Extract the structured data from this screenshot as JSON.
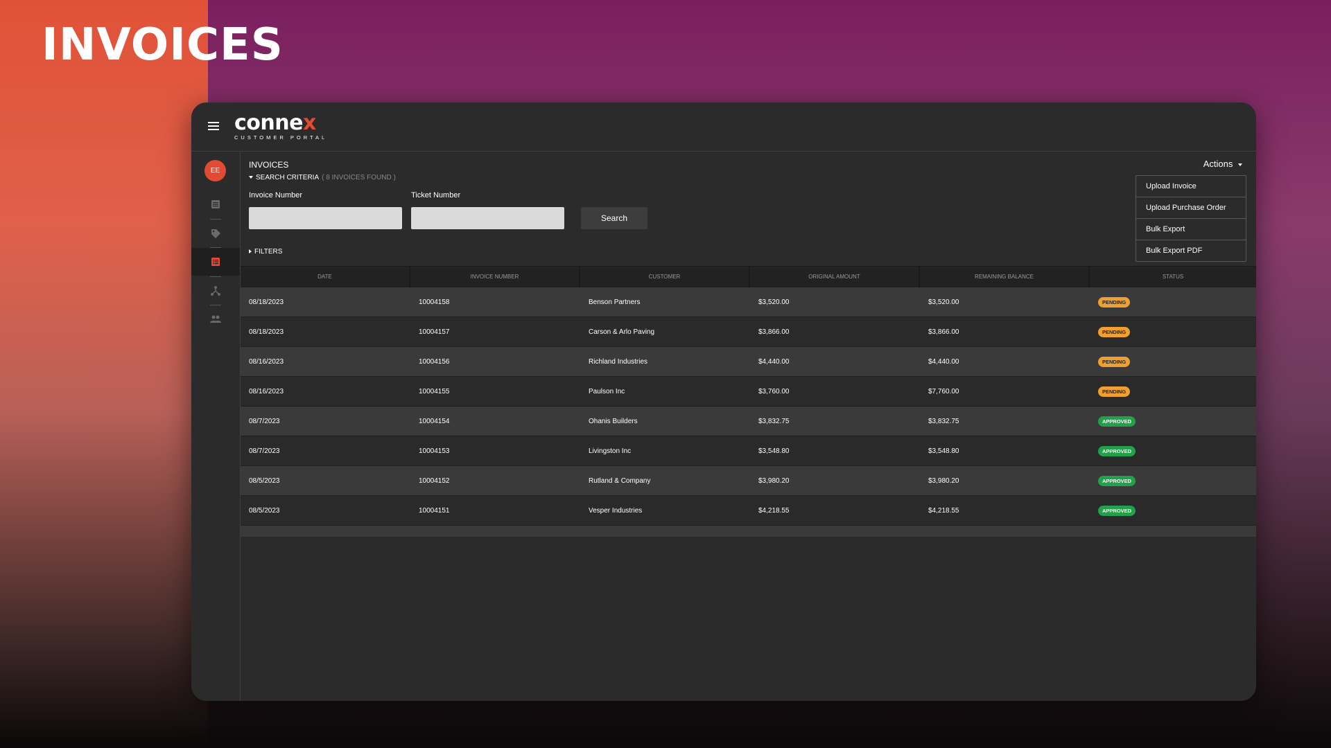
{
  "page": {
    "heading": "INVOICES"
  },
  "brand": {
    "name_main": "conne",
    "name_x": "x",
    "subtitle": "CUSTOMER PORTAL",
    "accent": "#e24a33"
  },
  "user": {
    "initials": "EE"
  },
  "sidebar": {
    "items": [
      {
        "icon": "document-icon",
        "active": false
      },
      {
        "icon": "tag-icon",
        "active": false
      },
      {
        "icon": "invoice-list-icon",
        "active": true
      },
      {
        "icon": "network-icon",
        "active": false
      },
      {
        "icon": "people-icon",
        "active": false
      }
    ]
  },
  "main": {
    "section_title": "INVOICES",
    "criteria_label": "SEARCH CRITERIA",
    "criteria_count": "( 8 INVOICES FOUND )",
    "invoice_number_label": "Invoice Number",
    "invoice_number_value": "",
    "ticket_number_label": "Ticket Number",
    "ticket_number_value": "",
    "search_label": "Search",
    "filters_label": "FILTERS"
  },
  "actions": {
    "label": "Actions",
    "menu": [
      "Upload Invoice",
      "Upload Purchase Order",
      "Bulk Export",
      "Bulk Export PDF"
    ]
  },
  "table": {
    "columns": [
      "DATE",
      "INVOICE NUMBER",
      "CUSTOMER",
      "ORIGINAL AMOUNT",
      "REMAINING BALANCE",
      "STATUS"
    ],
    "rows": [
      {
        "date": "08/18/2023",
        "invoice": "10004158",
        "customer": "Benson Partners",
        "original": "$3,520.00",
        "remaining": "$3,520.00",
        "status": "PENDING"
      },
      {
        "date": "08/18/2023",
        "invoice": "10004157",
        "customer": "Carson & Arlo Paving",
        "original": "$3,866.00",
        "remaining": "$3,866.00",
        "status": "PENDING"
      },
      {
        "date": "08/16/2023",
        "invoice": "10004156",
        "customer": "Richland Industries",
        "original": "$4,440.00",
        "remaining": "$4,440.00",
        "status": "PENDING"
      },
      {
        "date": "08/16/2023",
        "invoice": "10004155",
        "customer": "Paulson Inc",
        "original": "$3,760.00",
        "remaining": "$7,760.00",
        "status": "PENDING"
      },
      {
        "date": "08/7/2023",
        "invoice": "10004154",
        "customer": "Ohanis Builders",
        "original": "$3,832.75",
        "remaining": "$3,832.75",
        "status": "APPROVED"
      },
      {
        "date": "08/7/2023",
        "invoice": "10004153",
        "customer": "Livingston Inc",
        "original": "$3,548.80",
        "remaining": "$3,548.80",
        "status": "APPROVED"
      },
      {
        "date": "08/5/2023",
        "invoice": "10004152",
        "customer": "Rutland & Company",
        "original": "$3,980.20",
        "remaining": "$3,980.20",
        "status": "APPROVED"
      },
      {
        "date": "08/5/2023",
        "invoice": "10004151",
        "customer": "Vesper Industries",
        "original": "$4,218.55",
        "remaining": "$4,218.55",
        "status": "APPROVED"
      }
    ]
  },
  "colors": {
    "pending": "#f0a030",
    "approved": "#22a04a"
  }
}
